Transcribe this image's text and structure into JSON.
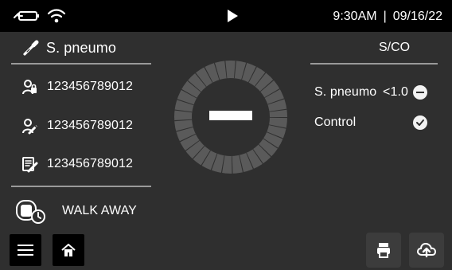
{
  "status": {
    "time": "9:30AM",
    "separator": "|",
    "date": "09/16/22"
  },
  "header": {
    "title": "S. pneumo",
    "right_label": "S/CO"
  },
  "left_list": {
    "items": [
      {
        "icon": "user-lock-icon",
        "value": "123456789012"
      },
      {
        "icon": "user-edit-icon",
        "value": "123456789012"
      },
      {
        "icon": "note-edit-icon",
        "value": "123456789012"
      }
    ],
    "footer": {
      "icon": "timer-device-icon",
      "label": "WALK AWAY"
    }
  },
  "results": {
    "rows": [
      {
        "name": "S. pneumo",
        "value": "<1.0",
        "status_icon": "minus-circle-icon"
      },
      {
        "name": "Control",
        "value": "",
        "status_icon": "check-circle-icon"
      }
    ]
  },
  "center": {
    "result_symbol": "negative-minus-icon"
  },
  "bottom": {
    "left_buttons": [
      {
        "icon": "menu-icon"
      },
      {
        "icon": "home-icon"
      }
    ],
    "right_buttons": [
      {
        "icon": "print-icon"
      },
      {
        "icon": "cloud-upload-icon"
      }
    ]
  },
  "colors": {
    "background": "#2f2f2f",
    "statusbar": "#000000",
    "text": "#ffffff",
    "divider": "#9a9a9a",
    "ring": "#5a5a5a"
  }
}
